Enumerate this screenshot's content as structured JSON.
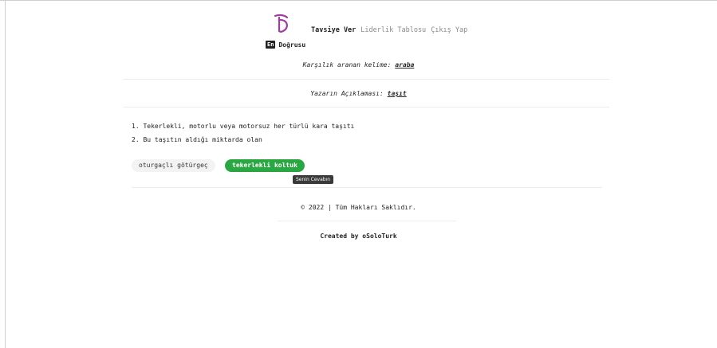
{
  "brand": {
    "badge": "En",
    "name": "Doğrusu"
  },
  "nav": {
    "items": [
      "Tavsiye Ver",
      "Liderlik Tablosu",
      "Çıkış Yap"
    ]
  },
  "search": {
    "label": "Karşılık aranan kelime:",
    "word": "araba"
  },
  "author": {
    "label": "Yazarın Açıklaması:",
    "word": "taşıt"
  },
  "definitions": [
    "1. Tekerlekli, motorlu veya motorsuz her türlü kara taşıtı",
    "2. Bu taşıtın aldığı miktarda olan"
  ],
  "choices": {
    "alt": "oturgaçlı götürgeç",
    "mine": "tekerlekli koltuk"
  },
  "tooltip": "Senin Cevabın",
  "footer": {
    "copyright": "© 2022 | Tüm Hakları Saklıdır.",
    "created": "Created by oSoloTurk"
  },
  "colors": {
    "accent_green": "#2aa743",
    "logo_purple": "#9b3ea0"
  }
}
